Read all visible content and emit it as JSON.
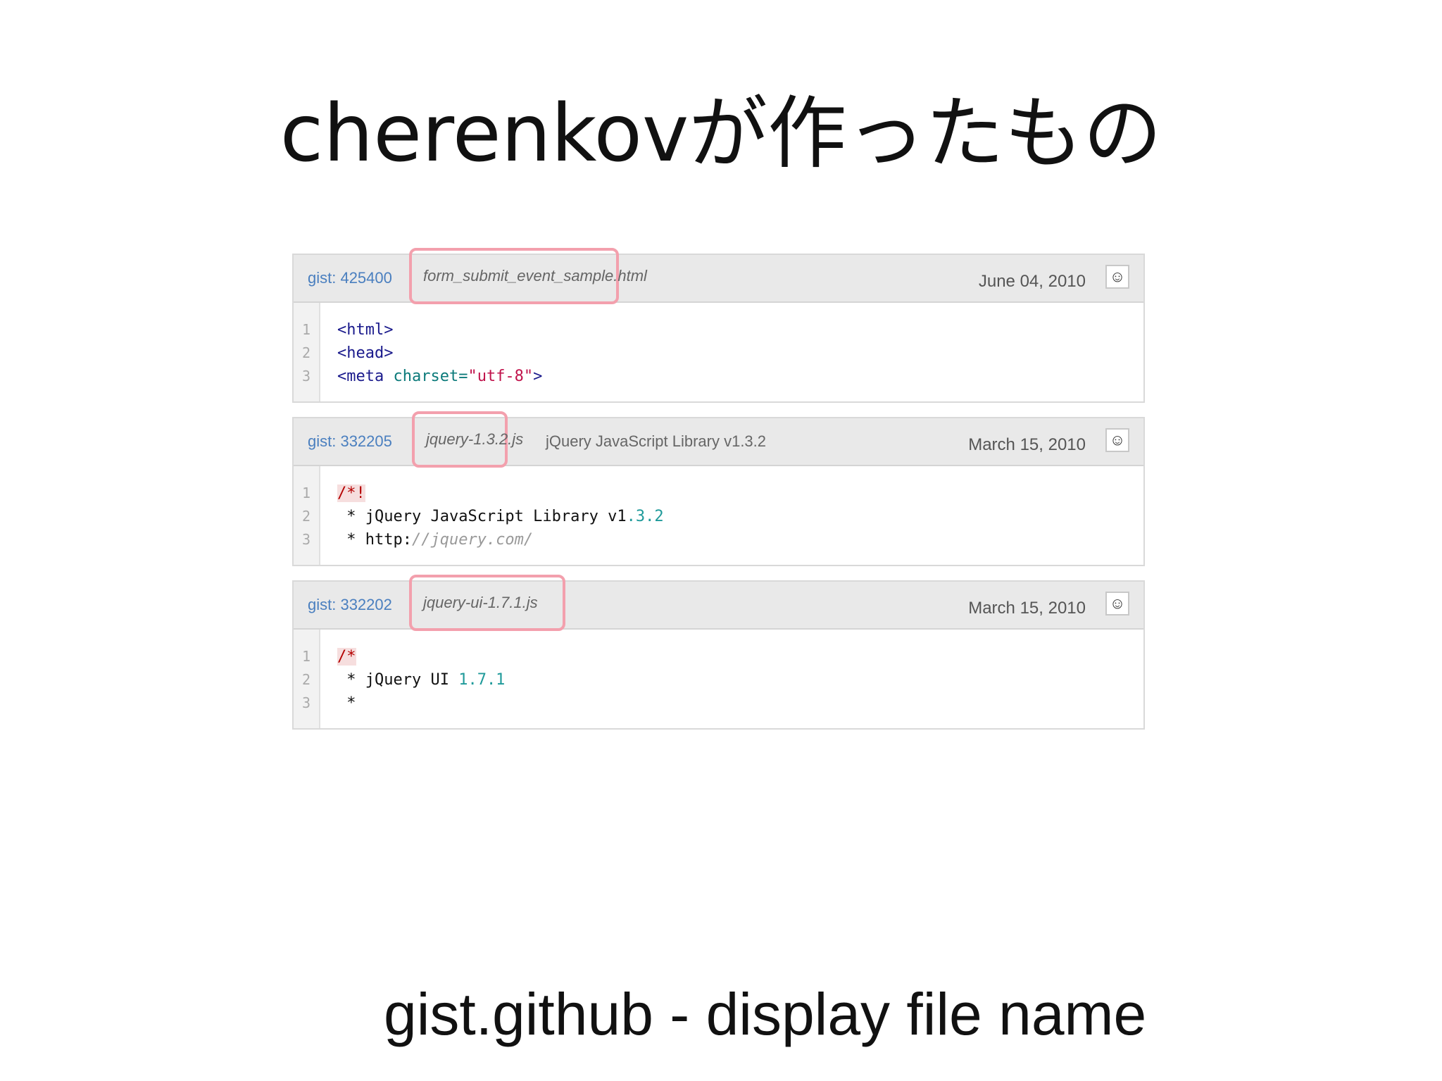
{
  "slide": {
    "title": "cherenkovが作ったもの",
    "footer": "gist.github - display file name"
  },
  "gists": [
    {
      "id_label": "gist: 425400",
      "filename": "form_submit_event_sample.html",
      "description": "",
      "date": "June 04, 2010",
      "avatar_icon": "avatar-icon",
      "line_numbers": [
        "1",
        "2",
        "3"
      ],
      "code": {
        "l1_tag": "<html>",
        "l2_tag": "<head>",
        "l3_tag": "<meta",
        "l3_attr": " charset=",
        "l3_str": "\"utf-8\"",
        "l3_close": ">"
      }
    },
    {
      "id_label": "gist: 332205",
      "filename": "jquery-1.3.2.js",
      "description": "jQuery JavaScript Library v1.3.2",
      "date": "March 15, 2010",
      "avatar_icon": "avatar-icon",
      "line_numbers": [
        "1",
        "2",
        "3"
      ],
      "code": {
        "l1_cmt": "/*!",
        "l2_star": " * ",
        "l2_text": "jQuery JavaScript Library v1",
        "l2_num": ".3.2",
        "l3_star": " * ",
        "l3_text": "http:",
        "l3_url": "//jquery.com/"
      }
    },
    {
      "id_label": "gist: 332202",
      "filename": "jquery-ui-1.7.1.js",
      "description": "",
      "date": "March 15, 2010",
      "avatar_icon": "avatar-icon",
      "line_numbers": [
        "1",
        "2",
        "3"
      ],
      "code": {
        "l1_cmt": "/*",
        "l2_star": " * ",
        "l2_text": "jQuery UI ",
        "l2_num": "1.7.1",
        "l3_star": " *"
      }
    }
  ],
  "colors": {
    "highlight_border": "#f3a0ad",
    "gist_link": "#4a7fbf",
    "header_bg": "#e9e9e9"
  }
}
